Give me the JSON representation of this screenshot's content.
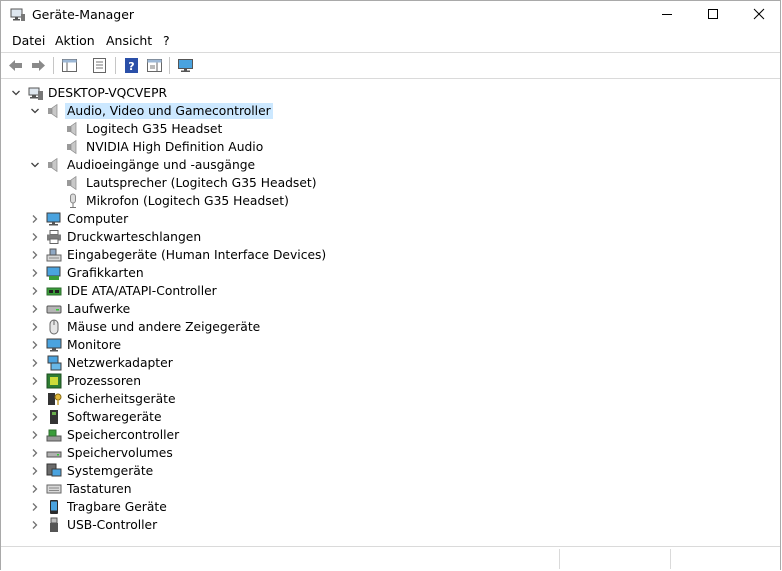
{
  "window": {
    "title": "Geräte-Manager"
  },
  "menu": [
    "Datei",
    "Aktion",
    "Ansicht",
    "?"
  ],
  "toolbar": {
    "buttons": [
      "back-icon",
      "forward-icon",
      "console-tree-icon",
      "properties-icon",
      "help-icon",
      "action-pane-icon",
      "monitor-scan-icon"
    ]
  },
  "tree": {
    "root": "DESKTOP-VQCVEPR",
    "categories": [
      {
        "label": "Audio, Video und Gamecontroller",
        "icon": "speaker-icon",
        "expanded": true,
        "selected": true,
        "children": [
          {
            "label": "Logitech G35 Headset",
            "icon": "speaker-icon"
          },
          {
            "label": "NVIDIA High Definition Audio",
            "icon": "speaker-icon"
          }
        ]
      },
      {
        "label": "Audioeingänge und -ausgänge",
        "icon": "speaker-icon",
        "expanded": true,
        "children": [
          {
            "label": "Lautsprecher (Logitech G35 Headset)",
            "icon": "speaker-icon"
          },
          {
            "label": "Mikrofon (Logitech G35 Headset)",
            "icon": "microphone-icon"
          }
        ]
      },
      {
        "label": "Computer",
        "icon": "computer-icon"
      },
      {
        "label": "Druckwarteschlangen",
        "icon": "printer-icon"
      },
      {
        "label": "Eingabegeräte (Human Interface Devices)",
        "icon": "hid-icon"
      },
      {
        "label": "Grafikkarten",
        "icon": "display-adapter-icon"
      },
      {
        "label": "IDE ATA/ATAPI-Controller",
        "icon": "ide-controller-icon"
      },
      {
        "label": "Laufwerke",
        "icon": "disk-drive-icon"
      },
      {
        "label": "Mäuse und andere Zeigegeräte",
        "icon": "mouse-icon"
      },
      {
        "label": "Monitore",
        "icon": "monitor-icon"
      },
      {
        "label": "Netzwerkadapter",
        "icon": "network-adapter-icon"
      },
      {
        "label": "Prozessoren",
        "icon": "processor-icon"
      },
      {
        "label": "Sicherheitsgeräte",
        "icon": "security-device-icon"
      },
      {
        "label": "Softwaregeräte",
        "icon": "software-device-icon"
      },
      {
        "label": "Speichercontroller",
        "icon": "storage-controller-icon"
      },
      {
        "label": "Speichervolumes",
        "icon": "storage-volume-icon"
      },
      {
        "label": "Systemgeräte",
        "icon": "system-device-icon"
      },
      {
        "label": "Tastaturen",
        "icon": "keyboard-icon"
      },
      {
        "label": "Tragbare Geräte",
        "icon": "portable-device-icon"
      },
      {
        "label": "USB-Controller",
        "icon": "usb-icon"
      }
    ]
  },
  "colors": {
    "selection": "#cce8ff",
    "accent": "#1e6fd9"
  }
}
